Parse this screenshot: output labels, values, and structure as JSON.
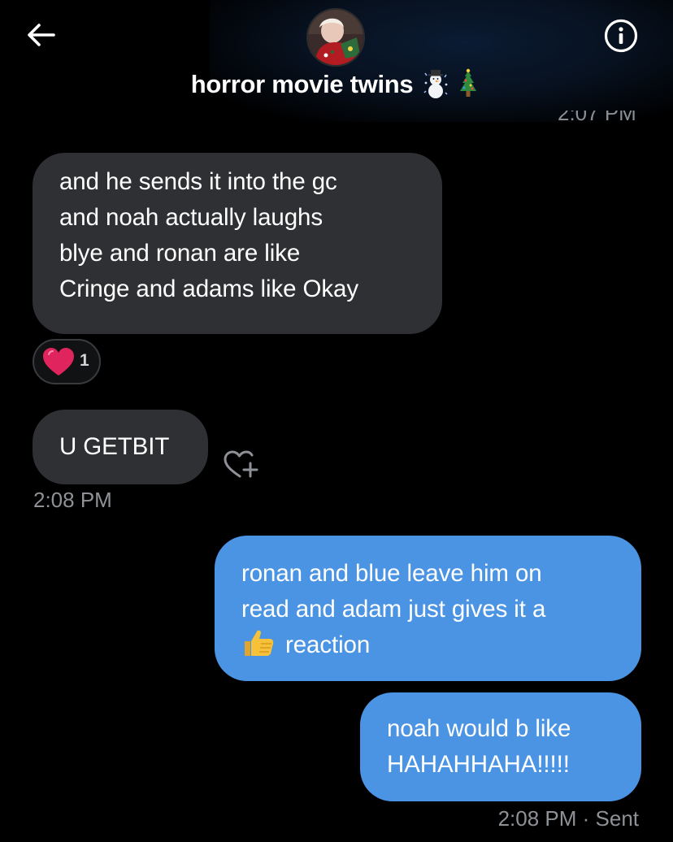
{
  "header": {
    "title": "horror movie twins",
    "title_emoji": [
      "snowman-icon",
      "christmas-tree-icon"
    ],
    "back_icon": "arrow-left-icon",
    "info_icon": "info-circle-icon",
    "avatar": "group-avatar"
  },
  "clipped_timestamp": "2:07 PM",
  "messages": [
    {
      "direction": "received",
      "lines": [
        "and he sends it into the gc",
        "and noah actually laughs",
        "blye and ronan are like",
        "Cringe and adams like Okay"
      ],
      "reaction": {
        "icon": "red-heart-icon",
        "count": "1"
      }
    },
    {
      "direction": "received",
      "lines": [
        "U GETBIT"
      ],
      "add_reaction_icon": "heart-plus-icon",
      "timestamp": "2:08 PM"
    },
    {
      "direction": "sent",
      "lines": [
        "ronan and blue leave him on",
        "read and adam just gives it a",
        "reaction"
      ],
      "inline_icon": "thumbs-up-icon"
    },
    {
      "direction": "sent",
      "lines": [
        "noah would b like",
        "HAHAHHAHA!!!!!"
      ],
      "timestamp": "2:08 PM",
      "status": "Sent"
    }
  ],
  "sent_footer": "2:08 PM · Sent",
  "colors": {
    "background": "#000000",
    "received_bubble": "#2f3033",
    "sent_bubble": "#4a94e3",
    "timestamp": "#8e9196",
    "heart": "#e0245e"
  }
}
